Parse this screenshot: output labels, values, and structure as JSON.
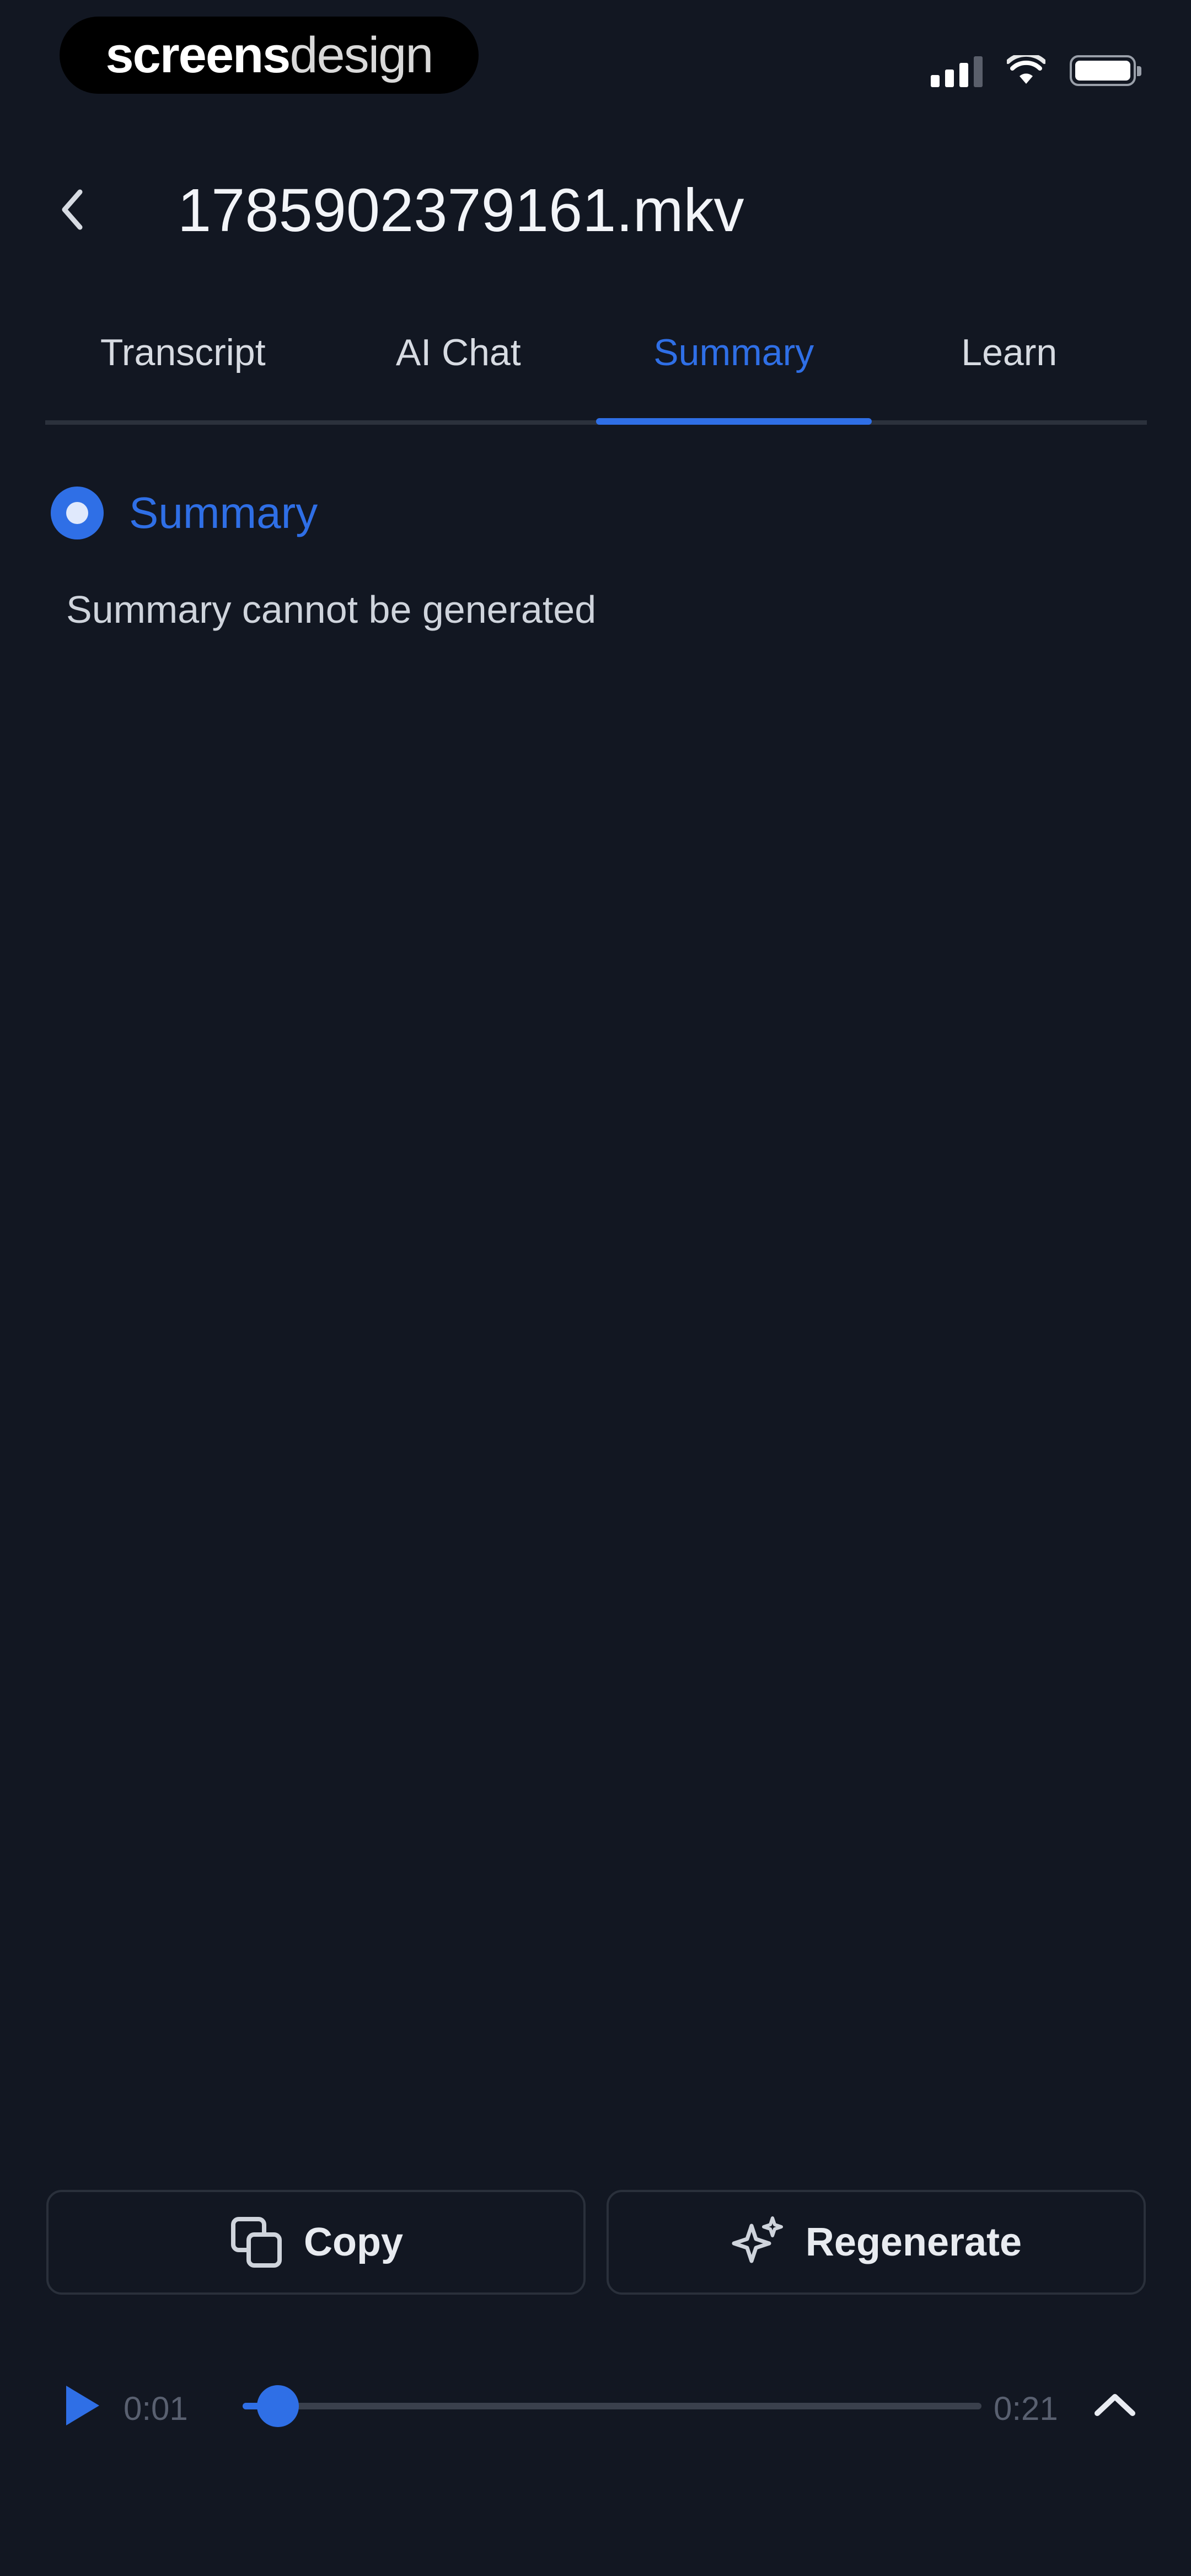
{
  "status_bar": {
    "brand_bold": "screens",
    "brand_light": "design"
  },
  "header": {
    "title": "1785902379161.mkv"
  },
  "tabs": [
    {
      "label": "Transcript"
    },
    {
      "label": "AI Chat"
    },
    {
      "label": "Summary",
      "active": true
    },
    {
      "label": "Learn"
    }
  ],
  "section": {
    "title": "Summary",
    "message": "Summary cannot be generated"
  },
  "actions": {
    "copy_label": "Copy",
    "regenerate_label": "Regenerate"
  },
  "player": {
    "current_time": "0:01",
    "total_time": "0:21",
    "progress": 0.048
  },
  "colors": {
    "background": "#121722",
    "accent": "#2f6fe6",
    "text": "#e9ecf2",
    "muted": "#596070"
  },
  "icons": {
    "back": "chevron-left-icon",
    "copy": "copy-icon",
    "regenerate": "sparkle-icon",
    "play": "play-icon",
    "expand": "chevron-up-icon"
  }
}
